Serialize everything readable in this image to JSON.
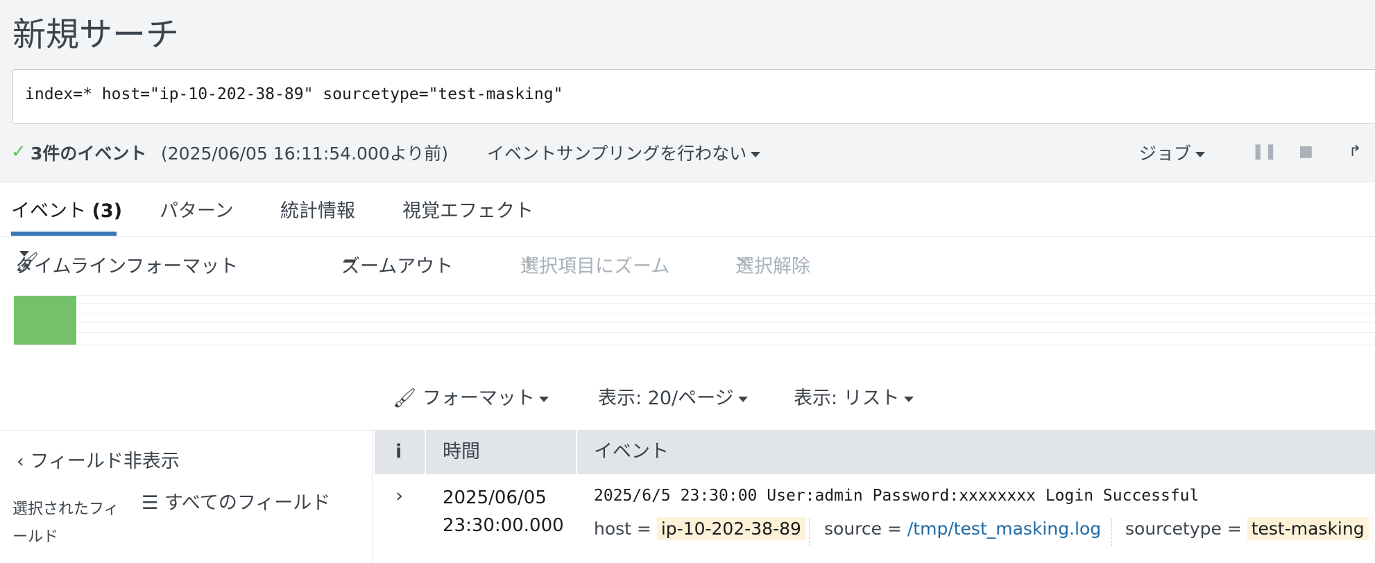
{
  "page": {
    "title": "新規サーチ"
  },
  "search": {
    "query": "index=* host=\"ip-10-202-38-89\" sourcetype=\"test-masking\""
  },
  "status": {
    "event_count": "3件のイベント",
    "since": "(2025/06/05 16:11:54.000より前)",
    "sampling": "イベントサンプリングを行わない",
    "job": "ジョブ"
  },
  "tabs": [
    {
      "label": "イベント",
      "count": "(3)"
    },
    {
      "label": "パターン"
    },
    {
      "label": "統計情報"
    },
    {
      "label": "視覚エフェクト"
    }
  ],
  "timeline_toolbar": {
    "format": "タイムラインフォーマット",
    "zoom_out": "ズームアウト",
    "zoom_selection": "選択項目にズーム",
    "deselect": "選択解除"
  },
  "colors": {
    "accent": "#3a76b9",
    "bar": "#73c267",
    "disabled": "#a9b2bb"
  },
  "results_toolbar": {
    "format": "フォーマット",
    "per_page": "表示: 20/ページ",
    "view": "表示: リスト"
  },
  "sidebar": {
    "hide_fields": "フィールド非表示",
    "selected_fields": "選択されたフィールド",
    "all_fields": "すべてのフィールド"
  },
  "table": {
    "headers": {
      "info": "i",
      "time": "時間",
      "event": "イベント"
    },
    "rows": [
      {
        "date": "2025/06/05",
        "time": "23:30:00.000",
        "raw": "2025/6/5 23:30:00 User:admin Password:xxxxxxxx Login Successful",
        "host_key": "host =",
        "host_val": "ip-10-202-38-89",
        "source_key": "source =",
        "source_val": "/tmp/test_masking.log",
        "sourcetype_key": "sourcetype =",
        "sourcetype_val": "test-masking"
      }
    ]
  }
}
